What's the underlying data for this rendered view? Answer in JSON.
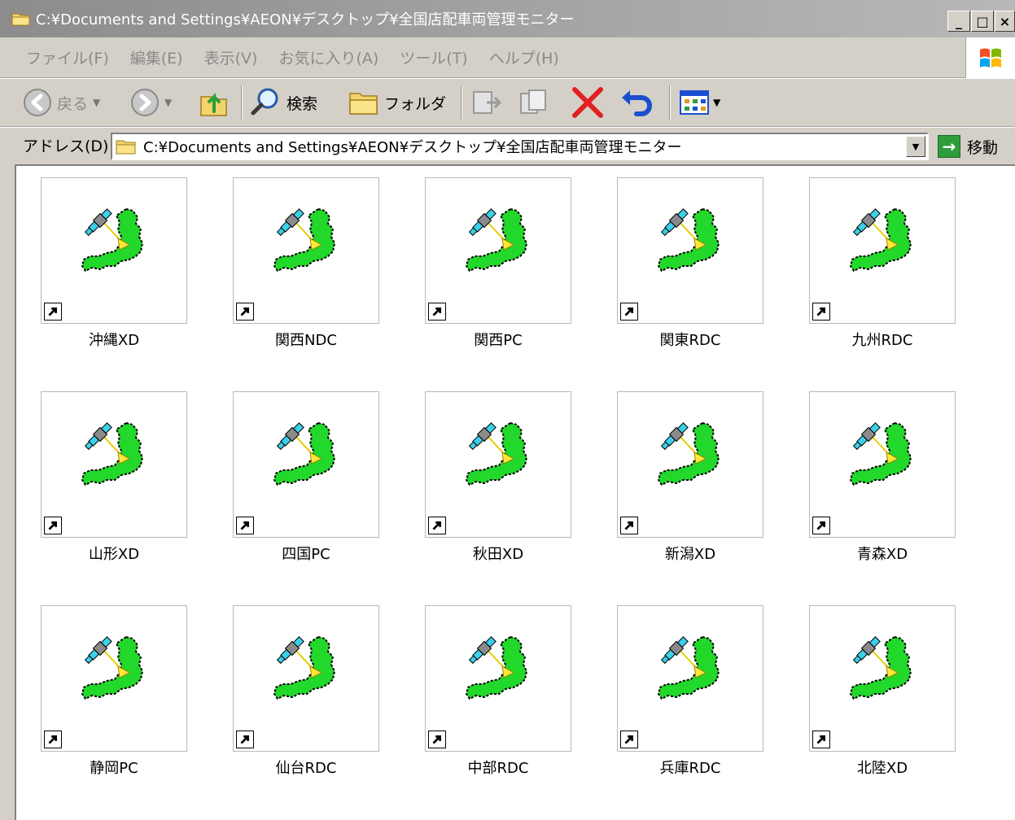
{
  "window": {
    "title": "C:¥Documents and Settings¥AEON¥デスクトップ¥全国店配車両管理モニター",
    "controls": {
      "minimize": "_",
      "maximize": "□",
      "close": "×"
    }
  },
  "menu": [
    "ファイル(F)",
    "編集(E)",
    "表示(V)",
    "お気に入り(A)",
    "ツール(T)",
    "ヘルプ(H)"
  ],
  "toolbar": {
    "back_label": "戻る",
    "search_label": "検索",
    "folders_label": "フォルダ"
  },
  "address": {
    "label": "アドレス(D)",
    "value": "C:¥Documents and Settings¥AEON¥デスクトップ¥全国店配車両管理モニター",
    "go_label": "移動"
  },
  "files": [
    "沖縄XD",
    "関西NDC",
    "関西PC",
    "関東RDC",
    "九州RDC",
    "山形XD",
    "四国PC",
    "秋田XD",
    "新潟XD",
    "青森XD",
    "静岡PC",
    "仙台RDC",
    "中部RDC",
    "兵庫RDC",
    "北陸XD"
  ],
  "icons": {
    "file_icon": "satellite-japan-map-icon",
    "overlay": "shortcut-arrow-icon"
  },
  "colors": {
    "map_green": "#22d82a",
    "title_gray": "#9a9a9a",
    "window_bg": "#d4d0c8"
  }
}
